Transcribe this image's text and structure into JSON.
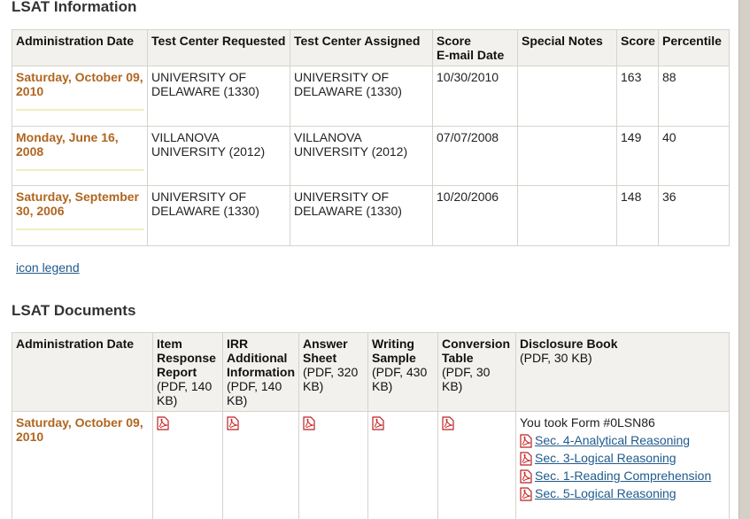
{
  "lsat_info": {
    "title_lsat": "LSAT",
    "title_rest": " Information",
    "headers": {
      "admin_date": "Administration Date",
      "center_requested": "Test Center Requested",
      "center_assigned": "Test Center Assigned",
      "score_email_line1": "Score",
      "score_email_line2": "E-mail Date",
      "special_notes": "Special Notes",
      "score": "Score",
      "percentile": "Percentile"
    },
    "rows": [
      {
        "date": "Saturday, October 09, 2010",
        "requested": "UNIVERSITY OF DELAWARE (1330)",
        "assigned": "UNIVERSITY OF DELAWARE (1330)",
        "email_date": "10/30/2010",
        "notes": "",
        "score": "163",
        "percentile": "88"
      },
      {
        "date": "Monday, June 16, 2008",
        "requested": "VILLANOVA UNIVERSITY (2012)",
        "assigned": "VILLANOVA UNIVERSITY (2012)",
        "email_date": "07/07/2008",
        "notes": "",
        "score": "149",
        "percentile": "40"
      },
      {
        "date": "Saturday, September 30, 2006",
        "requested": "UNIVERSITY OF DELAWARE (1330)",
        "assigned": "UNIVERSITY OF DELAWARE (1330)",
        "email_date": "10/20/2006",
        "notes": "",
        "score": "148",
        "percentile": "36"
      }
    ]
  },
  "icon_legend_label": "icon legend",
  "lsat_docs": {
    "title_lsat": "LSAT",
    "title_rest": " Documents",
    "headers": {
      "admin_date": "Administration Date",
      "item_response": "Item Response Report",
      "item_response_sub": "(PDF, 140 KB)",
      "irr_additional": "IRR Additional Information",
      "irr_additional_sub": "(PDF, 140 KB)",
      "answer_sheet": "Answer Sheet",
      "answer_sheet_sub": "(PDF, 320 KB)",
      "writing_sample": "Writing Sample",
      "writing_sample_sub": "(PDF, 430 KB)",
      "conversion_table": "Conversion Table",
      "conversion_table_sub": "(PDF, 30 KB)",
      "disclosure_book": "Disclosure Book",
      "disclosure_book_sub": "(PDF, 30 KB)"
    },
    "row": {
      "date": "Saturday, October 09, 2010",
      "form_text": "You took Form #0LSN86",
      "sections": [
        "Sec. 4-Analytical Reasoning",
        "Sec. 3-Logical Reasoning",
        "Sec. 1-Reading Comprehension",
        "Sec. 5-Logical Reasoning"
      ]
    }
  },
  "icons": {
    "pdf": "pdf-icon"
  },
  "colors": {
    "date": "#b0661f",
    "link": "#1f5a8c",
    "header_bg": "#f3f1ee"
  }
}
